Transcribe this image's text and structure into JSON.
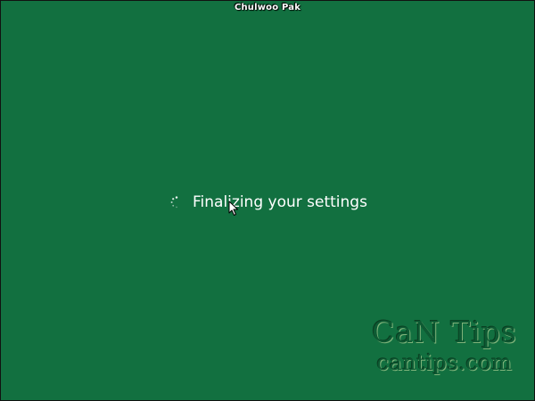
{
  "screen": {
    "user_name": "Chulwoo Pak",
    "status_text": "Finalizing your settings",
    "background_color": "#127040",
    "spinner_icon": "loading-spinner-icon",
    "cursor_icon": "mouse-pointer-icon"
  },
  "watermark": {
    "line1": "CaN Tips",
    "line2": "cantips.com"
  }
}
